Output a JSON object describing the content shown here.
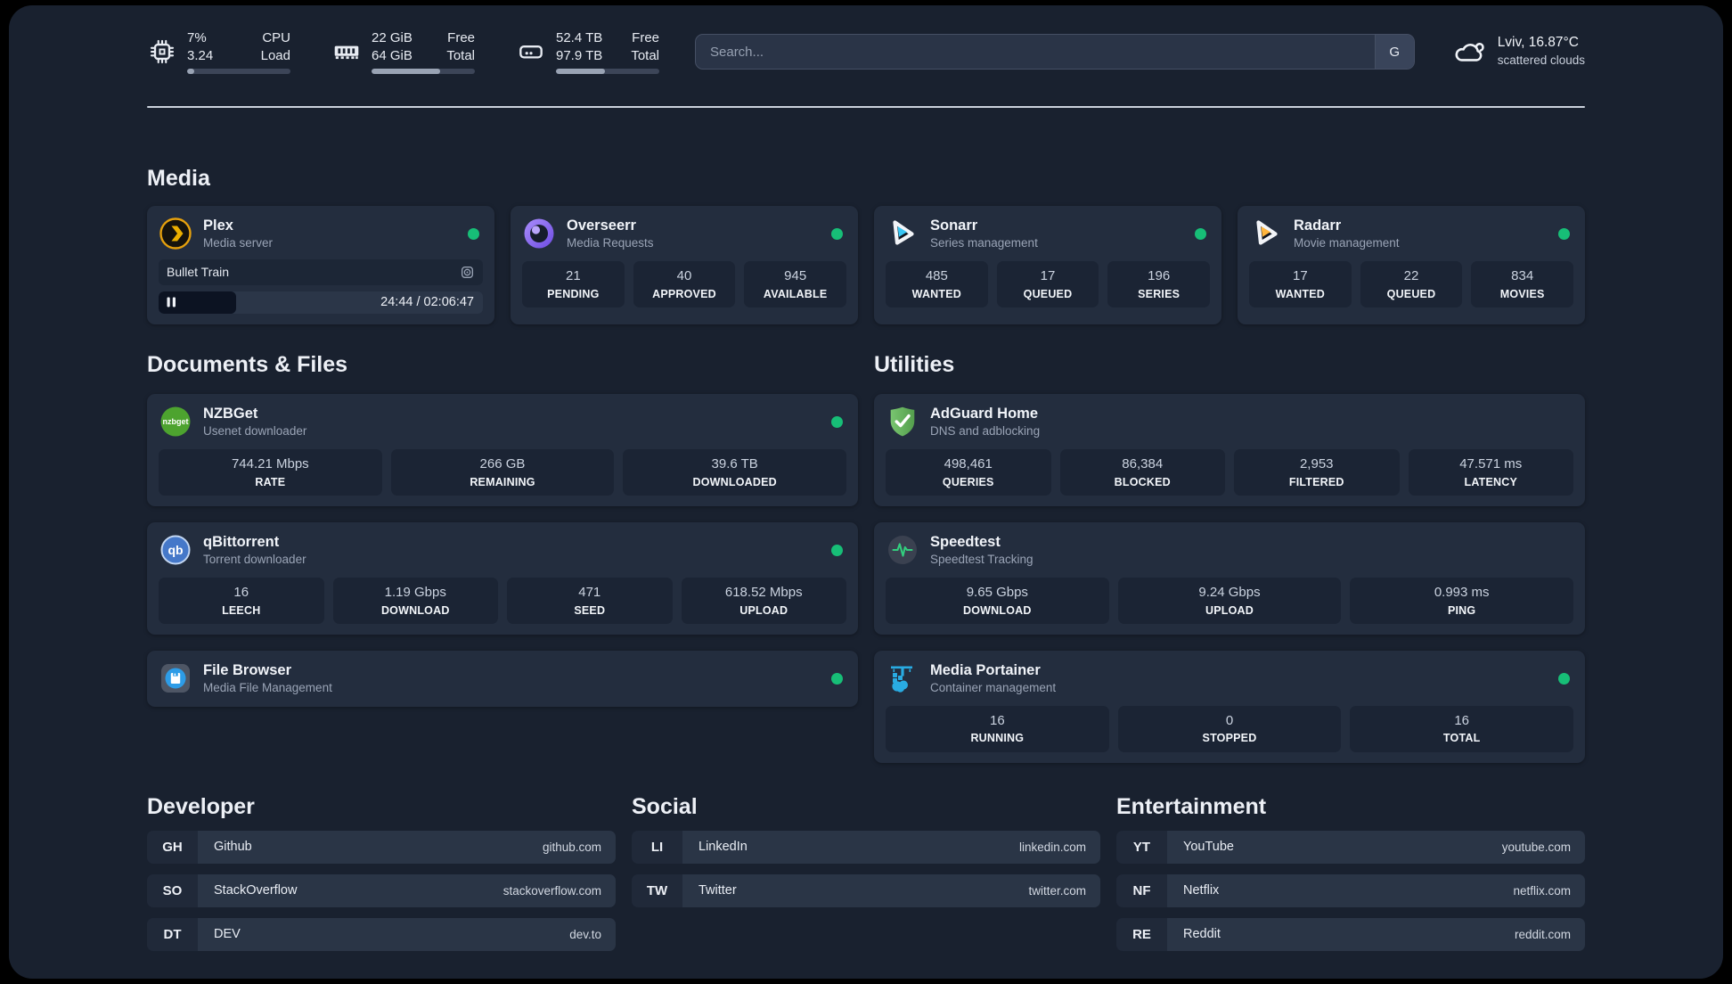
{
  "header": {
    "stats": [
      {
        "icon": "cpu-icon",
        "value_top": "7%",
        "value_bottom": "3.24",
        "label_top": "CPU",
        "label_bottom": "Load",
        "progress": 7
      },
      {
        "icon": "memory-icon",
        "value_top": "22 GiB",
        "value_bottom": "64 GiB",
        "label_top": "Free",
        "label_bottom": "Total",
        "progress": 66
      },
      {
        "icon": "disk-icon",
        "value_top": "52.4 TB",
        "value_bottom": "97.9 TB",
        "label_top": "Free",
        "label_bottom": "Total",
        "progress": 47
      }
    ],
    "search": {
      "placeholder": "Search...",
      "engine": "G"
    },
    "weather": {
      "icon": "cloud-icon",
      "location": "Lviv, 16.87°C",
      "condition": "scattered clouds"
    }
  },
  "sections": {
    "media": "Media",
    "documents": "Documents & Files",
    "utilities": "Utilities",
    "developer": "Developer",
    "social": "Social",
    "entertainment": "Entertainment"
  },
  "apps": {
    "plex": {
      "name": "Plex",
      "desc": "Media server",
      "status": "online",
      "player": {
        "title": "Bullet Train",
        "time": "24:44 / 02:06:47",
        "progress": 24
      }
    },
    "overseerr": {
      "name": "Overseerr",
      "desc": "Media Requests",
      "status": "online",
      "stats": [
        {
          "value": "21",
          "label": "PENDING"
        },
        {
          "value": "40",
          "label": "APPROVED"
        },
        {
          "value": "945",
          "label": "AVAILABLE"
        }
      ]
    },
    "sonarr": {
      "name": "Sonarr",
      "desc": "Series management",
      "status": "online",
      "stats": [
        {
          "value": "485",
          "label": "WANTED"
        },
        {
          "value": "17",
          "label": "QUEUED"
        },
        {
          "value": "196",
          "label": "SERIES"
        }
      ]
    },
    "radarr": {
      "name": "Radarr",
      "desc": "Movie management",
      "status": "online",
      "stats": [
        {
          "value": "17",
          "label": "WANTED"
        },
        {
          "value": "22",
          "label": "QUEUED"
        },
        {
          "value": "834",
          "label": "MOVIES"
        }
      ]
    },
    "nzbget": {
      "name": "NZBGet",
      "desc": "Usenet downloader",
      "status": "online",
      "icon_text": "nzbget",
      "stats": [
        {
          "value": "744.21 Mbps",
          "label": "RATE"
        },
        {
          "value": "266 GB",
          "label": "REMAINING"
        },
        {
          "value": "39.6 TB",
          "label": "DOWNLOADED"
        }
      ]
    },
    "qbittorrent": {
      "name": "qBittorrent",
      "desc": "Torrent downloader",
      "status": "online",
      "icon_text": "qb",
      "stats": [
        {
          "value": "16",
          "label": "LEECH"
        },
        {
          "value": "1.19 Gbps",
          "label": "DOWNLOAD"
        },
        {
          "value": "471",
          "label": "SEED"
        },
        {
          "value": "618.52 Mbps",
          "label": "UPLOAD"
        }
      ]
    },
    "filebrowser": {
      "name": "File Browser",
      "desc": "Media File Management",
      "status": "online"
    },
    "adguard": {
      "name": "AdGuard Home",
      "desc": "DNS and adblocking",
      "stats": [
        {
          "value": "498,461",
          "label": "QUERIES"
        },
        {
          "value": "86,384",
          "label": "BLOCKED"
        },
        {
          "value": "2,953",
          "label": "FILTERED"
        },
        {
          "value": "47.571 ms",
          "label": "LATENCY"
        }
      ]
    },
    "speedtest": {
      "name": "Speedtest",
      "desc": "Speedtest Tracking",
      "stats": [
        {
          "value": "9.65 Gbps",
          "label": "DOWNLOAD"
        },
        {
          "value": "9.24 Gbps",
          "label": "UPLOAD"
        },
        {
          "value": "0.993 ms",
          "label": "PING"
        }
      ]
    },
    "portainer": {
      "name": "Media Portainer",
      "desc": "Container management",
      "status": "online",
      "stats": [
        {
          "value": "16",
          "label": "RUNNING"
        },
        {
          "value": "0",
          "label": "STOPPED"
        },
        {
          "value": "16",
          "label": "TOTAL"
        }
      ]
    }
  },
  "bookmarks": {
    "developer": [
      {
        "abbr": "GH",
        "name": "Github",
        "url": "github.com"
      },
      {
        "abbr": "SO",
        "name": "StackOverflow",
        "url": "stackoverflow.com"
      },
      {
        "abbr": "DT",
        "name": "DEV",
        "url": "dev.to"
      }
    ],
    "social": [
      {
        "abbr": "LI",
        "name": "LinkedIn",
        "url": "linkedin.com"
      },
      {
        "abbr": "TW",
        "name": "Twitter",
        "url": "twitter.com"
      }
    ],
    "entertainment": [
      {
        "abbr": "YT",
        "name": "YouTube",
        "url": "youtube.com"
      },
      {
        "abbr": "NF",
        "name": "Netflix",
        "url": "netflix.com"
      },
      {
        "abbr": "RE",
        "name": "Reddit",
        "url": "reddit.com"
      }
    ]
  },
  "colors": {
    "status_online": "#17BE77",
    "plex_gold": "#E5A00D",
    "page_bg": "#19212F",
    "card_bg": "#232D3E"
  }
}
